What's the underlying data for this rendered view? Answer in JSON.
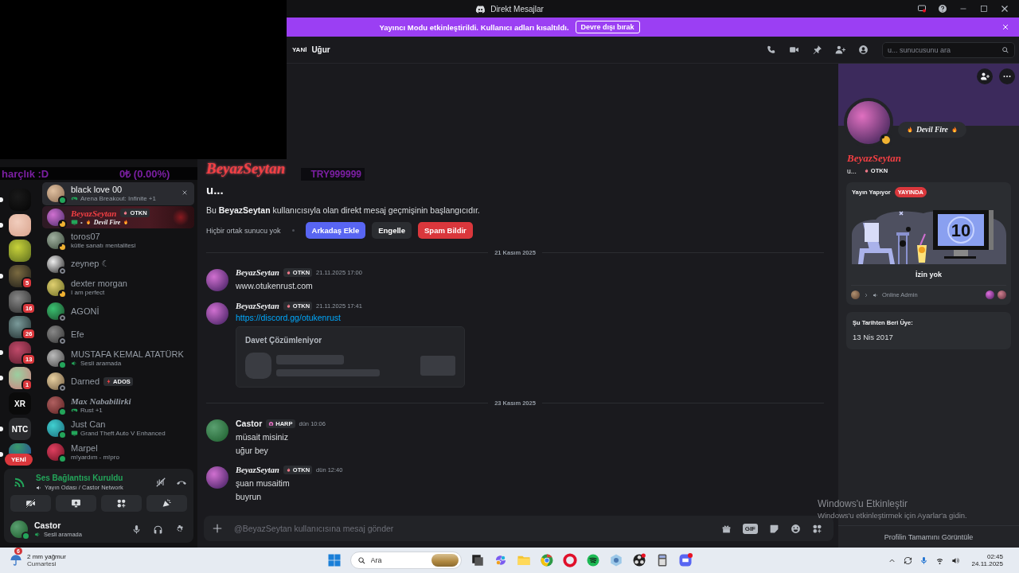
{
  "overlays": {
    "tip_label": "harçlık :D",
    "tip_amount": "0₺ (0.00%)",
    "goal_amount": "TRY999999"
  },
  "titlebar": {
    "title": "Direkt Mesajlar"
  },
  "banner": {
    "text": "Yayıncı Modu etkinleştirildi. Kullanıcı adları kısaltıldı.",
    "button": "Devre dışı bırak"
  },
  "servers": [
    {
      "kind": "avatar",
      "unread": true
    },
    {
      "kind": "avatar",
      "unread": true
    },
    {
      "kind": "avatar",
      "unread": false
    },
    {
      "kind": "avatar",
      "unread": true,
      "badge": "5"
    },
    {
      "kind": "avatar",
      "unread": false,
      "badge": "16"
    },
    {
      "kind": "avatar",
      "unread": false,
      "badge": "26"
    },
    {
      "kind": "avatar",
      "unread": true,
      "badge": "13"
    },
    {
      "kind": "avatar",
      "unread": true,
      "badge": "1"
    },
    {
      "kind": "logo",
      "unread": false,
      "label": "XR"
    },
    {
      "kind": "logo",
      "unread": true,
      "label": "NTC"
    },
    {
      "kind": "avatar",
      "unread": true
    }
  ],
  "new_pill": "YENİ",
  "dms": [
    {
      "name": "black love 00",
      "color": "#23a55a",
      "idle": false,
      "offline": false,
      "kind": "game",
      "activity": "Arena Breakout: Infinite +1",
      "hovered": true,
      "selected": false,
      "fancy": false
    },
    {
      "name": "BeyazSeytan",
      "color": "#f0b232",
      "idle": true,
      "offline": false,
      "tag": "OTKN",
      "kind": "screen",
      "separator": "•",
      "activity": "Devil Fire",
      "flames": true,
      "hovered": false,
      "selected": true,
      "fancy": true
    },
    {
      "name": "toros07",
      "color": "#f0b232",
      "idle": true,
      "offline": false,
      "kind": "plain",
      "activity": "kütle sanatı mentalitesi",
      "hovered": false,
      "selected": false,
      "fancy": false
    },
    {
      "name": "zeynep ☾",
      "color": "#80848e",
      "idle": false,
      "offline": true,
      "kind": "plain",
      "hovered": false,
      "selected": false,
      "fancy": false
    },
    {
      "name": "dexter morgan",
      "color": "#f0b232",
      "idle": true,
      "offline": false,
      "kind": "plain",
      "activity": "I am perfect",
      "hovered": false,
      "selected": false,
      "fancy": false
    },
    {
      "name": "AGONİ",
      "color": "#80848e",
      "idle": false,
      "offline": true,
      "kind": "plain",
      "hovered": false,
      "selected": false,
      "fancy": false
    },
    {
      "name": "Efe",
      "color": "#80848e",
      "idle": false,
      "offline": true,
      "kind": "plain",
      "hovered": false,
      "selected": false,
      "fancy": false
    },
    {
      "name": "MUSTAFA KEMAL ATATÜRK",
      "color": "#23a55a",
      "idle": false,
      "offline": false,
      "kind": "voice",
      "activity": "Sesli aramada",
      "hovered": false,
      "selected": false,
      "fancy": false
    },
    {
      "name": "Darned",
      "color": "#80848e",
      "idle": false,
      "offline": true,
      "kind": "plain",
      "tag": "ADOS",
      "hovered": false,
      "selected": false,
      "fancy": false
    },
    {
      "name": "Max Nababilirki",
      "color": "#23a55a",
      "idle": false,
      "offline": false,
      "kind": "game",
      "activity": "Rust +1",
      "hovered": false,
      "selected": false,
      "fancy": true
    },
    {
      "name": "Just Can",
      "color": "#23a55a",
      "idle": false,
      "offline": false,
      "kind": "screen",
      "activity": "Grand Theft Auto V Enhanced",
      "hovered": false,
      "selected": false,
      "fancy": false
    },
    {
      "name": "Marpel",
      "color": "#23a55a",
      "idle": false,
      "offline": false,
      "kind": "plain",
      "activity": "m!yardım - m!pro",
      "hovered": false,
      "selected": false,
      "fancy": false
    }
  ],
  "voice": {
    "status": "Ses Bağlantısı Kuruldu",
    "channel": "Yayın Odası / Castor Network"
  },
  "user": {
    "name": "Castor",
    "online": true,
    "activity": "Sesli aramada"
  },
  "header": {
    "prefix": "YANİ",
    "name": "Uğur",
    "search_placeholder": "u... sunucusunu ara"
  },
  "intro": {
    "name": "BeyazSeytan",
    "username": "u...",
    "text": "Bu **BeyazSeytan** kullanıcısıyla olan direkt mesaj geçmişinin başlangıcıdır.",
    "mutual": "Hiçbir ortak sunucu yok",
    "buttons": [
      {
        "label": "Arkadaş Ekle",
        "kind": "primary"
      },
      {
        "label": "Engelle",
        "kind": "secondary"
      },
      {
        "label": "Spam Bildir",
        "kind": "danger"
      }
    ]
  },
  "messages": [
    {
      "kind": "divider",
      "text": "21 Kasım 2025"
    },
    {
      "kind": "message",
      "author": "BeyazSeytan",
      "fancy": true,
      "tag": "OTKN",
      "time": "21.11.2025 17:00",
      "lines": [
        {
          "text": "www.otukenrust.com",
          "link": false
        }
      ]
    },
    {
      "kind": "message",
      "author": "BeyazSeytan",
      "fancy": true,
      "tag": "OTKN",
      "time": "21.11.2025 17:41",
      "lines": [
        {
          "text": "https://discord.gg/otukenrust",
          "link": true
        }
      ],
      "embed": {
        "title": "Davet Çözümleniyor"
      }
    },
    {
      "kind": "divider",
      "text": "23 Kasım 2025"
    },
    {
      "kind": "message",
      "author": "Castor",
      "fancy": false,
      "tag": "HARP",
      "time": "dün 10:06",
      "lines": [
        {
          "text": "müsait misiniz",
          "link": false
        },
        {
          "text": "uğur bey",
          "link": false
        }
      ]
    },
    {
      "kind": "message",
      "author": "BeyazSeytan",
      "fancy": true,
      "tag": "OTKN",
      "time": "dün 12:40",
      "lines": [
        {
          "text": "şuan musaitim",
          "link": false
        },
        {
          "text": "buyrun",
          "link": false
        }
      ]
    }
  ],
  "composer": {
    "placeholder": "@BeyazSeytan kullanıcısına mesaj gönder",
    "gif_label": "GIF"
  },
  "profile": {
    "status": "Devil Fire",
    "name": "BeyazSeytan",
    "username": "u...",
    "tag": "OTKN",
    "idle": true,
    "stream": {
      "label": "Yayın Yapıyor",
      "badge": "YAYINDA",
      "countdown": "10",
      "caption": "İzin yok",
      "channel": "Online Admin"
    },
    "member_since": {
      "label": "Şu Tarihten Beri Üye:",
      "date": "13 Nis 2017"
    },
    "full_profile": "Profilin Tamamını Görüntüle"
  },
  "watermark": {
    "title": "Windows'u Etkinleştir",
    "text": "Windows'u etkinleştirmek için Ayarlar'a gidin."
  },
  "taskbar": {
    "weather": {
      "badge": "6",
      "title": "2 mm yağmur",
      "subtitle": "Cumartesi"
    },
    "search_placeholder": "Ara",
    "time": "02:45",
    "date": "24.11.2025"
  }
}
